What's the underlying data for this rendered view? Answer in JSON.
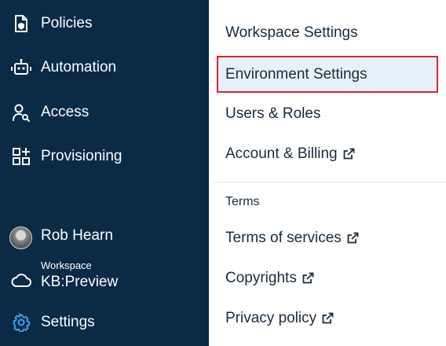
{
  "sidebar": {
    "items": [
      {
        "label": "Policies",
        "icon": "policy-document-icon"
      },
      {
        "label": "Automation",
        "icon": "robot-icon"
      },
      {
        "label": "Access",
        "icon": "user-search-icon"
      },
      {
        "label": "Provisioning",
        "icon": "grid-plus-icon"
      }
    ],
    "user": {
      "name": "Rob Hearn"
    },
    "workspace": {
      "caption": "Workspace",
      "name": "KB:Preview",
      "icon": "cloud-icon"
    },
    "settings": {
      "label": "Settings",
      "icon": "gear-icon",
      "accent": "#3aa7f0"
    }
  },
  "menu": {
    "items": [
      {
        "label": "Workspace Settings",
        "external": false
      },
      {
        "label": "Environment Settings",
        "external": false,
        "selected": true
      },
      {
        "label": "Users & Roles",
        "external": false
      },
      {
        "label": "Account & Billing",
        "external": true
      }
    ],
    "terms_section": {
      "heading": "Terms",
      "items": [
        {
          "label": "Terms of services",
          "external": true
        },
        {
          "label": "Copyrights",
          "external": true
        },
        {
          "label": "Privacy policy",
          "external": true
        }
      ]
    }
  },
  "colors": {
    "sidebar_bg": "#0b2a45",
    "selected_bg": "#e6f2fb",
    "highlight_border": "#e0242e",
    "text": "#1a2b3c"
  }
}
